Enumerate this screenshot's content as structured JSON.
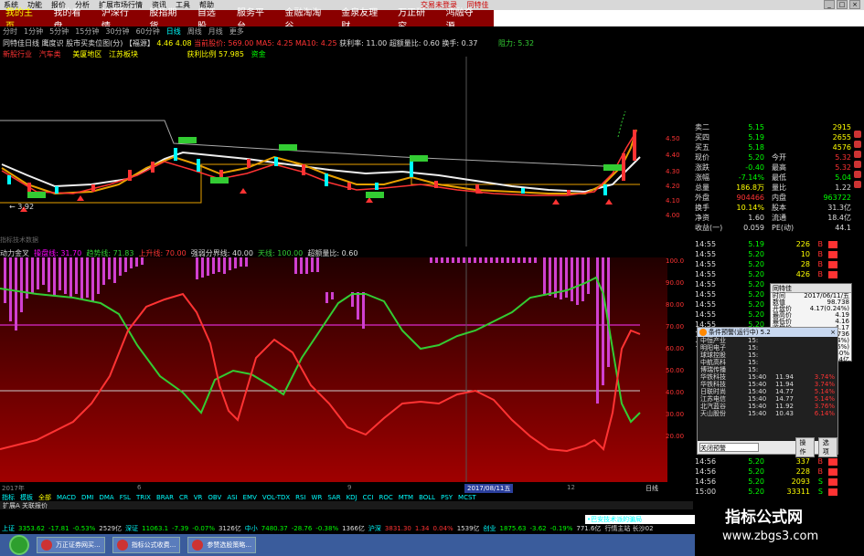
{
  "menubar": {
    "items": [
      "系统",
      "功能",
      "报价",
      "分析",
      "扩展市场行情",
      "资讯",
      "工具",
      "帮助"
    ],
    "links": [
      "交易未登录",
      "同特佳"
    ]
  },
  "nav": {
    "tabs": [
      "我的主页",
      "我的看盘",
      "沪深行情",
      "股指期货",
      "自选股",
      "服务平台",
      "金融淘淘谷",
      "金泉友理财",
      "万正研究",
      "鸿融夺源"
    ]
  },
  "subtool": {
    "items": [
      "分时",
      "1分钟",
      "5分钟",
      "15分钟",
      "30分钟",
      "60分钟",
      "日线",
      "周线",
      "月线",
      "更多"
    ],
    "selected_index": 6
  },
  "info1": {
    "name": "同特佳日线 鹰度识 股市买卖位图(分) 【福源】",
    "v1": "4.46",
    "label2": "【福源】",
    "v2": "4.08",
    "ma": "当前股价: 569.00 MA5: 4.25 MA10: 4.25",
    "prof": "获利率: 11.00",
    "ratio": "超额量比: 0.60",
    "turn": "换手: 0.37",
    "right": "阻力: 5.32"
  },
  "info2": {
    "a": "新股行业",
    "b": "汽车类",
    "c": "美厦地区",
    "d": "江苏板块",
    "e": "获利比例 57.985",
    "f": "资金"
  },
  "price_axis": [
    "4.50",
    "4.40",
    "4.30",
    "4.20",
    "4.10",
    "4.00"
  ],
  "osc_axis": [
    "100.0",
    "90.00",
    "80.00",
    "70.00",
    "60.00",
    "50.00",
    "40.00",
    "30.00",
    "20.00"
  ],
  "osc_header": {
    "a": "动力金叉",
    "b": "操盘线: 31.70",
    "c": "趋势线: 71.83",
    "d": "上升线: 70.00",
    "e": "强弱分界线: 40.00",
    "f": "天线: 100.00",
    "g": "超额量比: 0.60"
  },
  "divider_text": "指标技术数据",
  "quote": [
    {
      "l": "卖二",
      "v": "5.15",
      "c": "green",
      "v2": "2915"
    },
    {
      "l": "买四",
      "v": "5.19",
      "c": "green",
      "v2": "2655"
    },
    {
      "l": "买五",
      "v": "5.18",
      "c": "green",
      "v2": "4576"
    },
    {
      "l": "现价",
      "v": "5.20",
      "c": "green",
      "l2": "今开",
      "v3": "5.32",
      "c3": "red"
    },
    {
      "l": "涨跌",
      "v": "-0.40",
      "c": "green",
      "l2": "最高",
      "v3": "5.32",
      "c3": "red"
    },
    {
      "l": "涨幅",
      "v": "-7.14%",
      "c": "green",
      "l2": "最低",
      "v3": "5.04",
      "c3": "green"
    },
    {
      "l": "总量",
      "v": "186.8万",
      "c": "yellow",
      "l2": "量比",
      "v3": "1.22",
      "c3": "white"
    },
    {
      "l": "外盘",
      "v": "904466",
      "c": "red",
      "l2": "内盘",
      "v3": "963722",
      "c3": "green"
    },
    {
      "l": "换手",
      "v": "10.14%",
      "c": "yellow",
      "l2": "股本",
      "v3": "31.3亿",
      "c3": "white"
    },
    {
      "l": "净资",
      "v": "1.60",
      "c": "white",
      "l2": "流通",
      "v3": "18.4亿",
      "c3": "white"
    },
    {
      "l": "收益(一)",
      "v": "0.059",
      "c": "white",
      "l2": "PE(动)",
      "v3": "44.1",
      "c3": "white"
    }
  ],
  "ticks": [
    {
      "t": "14:55",
      "p": "5.19",
      "v": "226",
      "bs": "B"
    },
    {
      "t": "14:55",
      "p": "5.20",
      "v": "10",
      "bs": "B"
    },
    {
      "t": "14:55",
      "p": "5.20",
      "v": "28",
      "bs": "B"
    },
    {
      "t": "14:55",
      "p": "5.20",
      "v": "426",
      "bs": "B"
    },
    {
      "t": "14:55",
      "p": "5.20",
      "v": "",
      "bs": ""
    },
    {
      "t": "14:55",
      "p": "5.20",
      "v": "",
      "bs": ""
    },
    {
      "t": "14:55",
      "p": "5.20",
      "v": "",
      "bs": ""
    },
    {
      "t": "14:55",
      "p": "5.20",
      "v": "",
      "bs": ""
    },
    {
      "t": "14:55",
      "p": "5.20",
      "v": "",
      "bs": ""
    },
    {
      "t": "14:55",
      "p": "5.20",
      "v": "",
      "bs": ""
    },
    {
      "t": "14:55",
      "p": "5.20",
      "v": "",
      "bs": ""
    }
  ],
  "ticks2": [
    {
      "t": "14:56",
      "p": "5.20",
      "v": "337",
      "bs": "B"
    },
    {
      "t": "14:56",
      "p": "5.20",
      "v": "228",
      "bs": "B"
    },
    {
      "t": "14:56",
      "p": "5.20",
      "v": "2093",
      "bs": "S"
    },
    {
      "t": "15:00",
      "p": "5.20",
      "v": "33311",
      "bs": "S"
    }
  ],
  "popup1": {
    "title": "同特佳",
    "rows": [
      [
        "时间",
        "2017/06/11/五"
      ],
      [
        "数值",
        "98.738"
      ],
      [
        "开盘价",
        "4.17(0.24%)"
      ],
      [
        "最高价",
        "4.19"
      ],
      [
        "最低价",
        "4.16"
      ],
      [
        "收盘价",
        "4.17"
      ],
      [
        "成交量",
        "67736"
      ],
      [
        "涨幅",
        "+0.01(+0.24%)"
      ],
      [
        "振幅",
        "0.09(2.16%)"
      ],
      [
        "换手率",
        "0.40%"
      ],
      [
        "流通股",
        "18.44亿"
      ]
    ]
  },
  "popup2": {
    "title": "条件预警(运行中) 5.2",
    "rows": [
      [
        "中恒产业",
        "15:",
        "",
        ""
      ],
      [
        "明阳电子",
        "15:",
        "",
        ""
      ],
      [
        "球球控股",
        "15:",
        "",
        ""
      ],
      [
        "中航高科",
        "15:",
        "",
        ""
      ],
      [
        "博瑞传播",
        "15:",
        "",
        ""
      ],
      [
        "华铁科技",
        "15:40",
        "11.94",
        "3.74%"
      ],
      [
        "华铁科技",
        "15:40",
        "11.94",
        "3.74%"
      ],
      [
        "日联时尚",
        "15:40",
        "14.77",
        "5.14%"
      ],
      [
        "江苏电信",
        "15:40",
        "14.77",
        "5.14%"
      ],
      [
        "北汽蓝谷",
        "15:40",
        "11.92",
        "3.76%"
      ],
      [
        "天山股份",
        "15:40",
        "10.43",
        "6.14%"
      ]
    ],
    "input": "关闭预警",
    "btn1": "操作",
    "btn2": "选项"
  },
  "xaxis": {
    "left": "2017年",
    "mid": "6",
    "mid2": "9",
    "mid3": "12",
    "date": "2017/08/11五",
    "right": "日线"
  },
  "idx_tabs": [
    "指标",
    "模板",
    "全部",
    "MACD",
    "DMI",
    "DMA",
    "FSL",
    "TRIX",
    "BRAR",
    "CR",
    "VR",
    "OBV",
    "ASI",
    "EMV",
    "VOL-TDX",
    "RSI",
    "WR",
    "SAR",
    "KDJ",
    "CCI",
    "ROC",
    "MTM",
    "BOLL",
    "PSY",
    "MCST"
  ],
  "bottom_tabs": "扩展A  关联报价",
  "ticker": [
    {
      "t": "上证",
      "c": "cyan"
    },
    {
      "t": "3353.62",
      "c": "green"
    },
    {
      "t": "-17.81",
      "c": "green"
    },
    {
      "t": "-0.53%",
      "c": "green"
    },
    {
      "t": "2529亿",
      "c": "white"
    },
    {
      "t": "深证",
      "c": "cyan"
    },
    {
      "t": "11063.1",
      "c": "green"
    },
    {
      "t": "-7.39",
      "c": "green"
    },
    {
      "t": "-0.07%",
      "c": "green"
    },
    {
      "t": "3126亿",
      "c": "white"
    },
    {
      "t": "中小",
      "c": "cyan"
    },
    {
      "t": "7480.37",
      "c": "green"
    },
    {
      "t": "-28.76",
      "c": "green"
    },
    {
      "t": "-0.38%",
      "c": "green"
    },
    {
      "t": "1366亿",
      "c": "white"
    },
    {
      "t": "沪深",
      "c": "cyan"
    },
    {
      "t": "3831.30",
      "c": "red"
    },
    {
      "t": "1.34",
      "c": "red"
    },
    {
      "t": "0.04%",
      "c": "red"
    },
    {
      "t": "1539亿",
      "c": "white"
    },
    {
      "t": "创业",
      "c": "cyan"
    },
    {
      "t": "1875.63",
      "c": "green"
    },
    {
      "t": "-3.62",
      "c": "green"
    },
    {
      "t": "-0.19%",
      "c": "green"
    },
    {
      "t": "771.6亿",
      "c": "white"
    },
    {
      "t": "行情主站 长沙02",
      "c": "white"
    }
  ],
  "marquee": "•巴安技术派的骗局",
  "taskbar": [
    "万正证券网买...",
    "指标公式收费...",
    "参赞选股策略..."
  ],
  "watermark": {
    "line1": "指标公式网",
    "line2": "www.zbgs3.com"
  }
}
